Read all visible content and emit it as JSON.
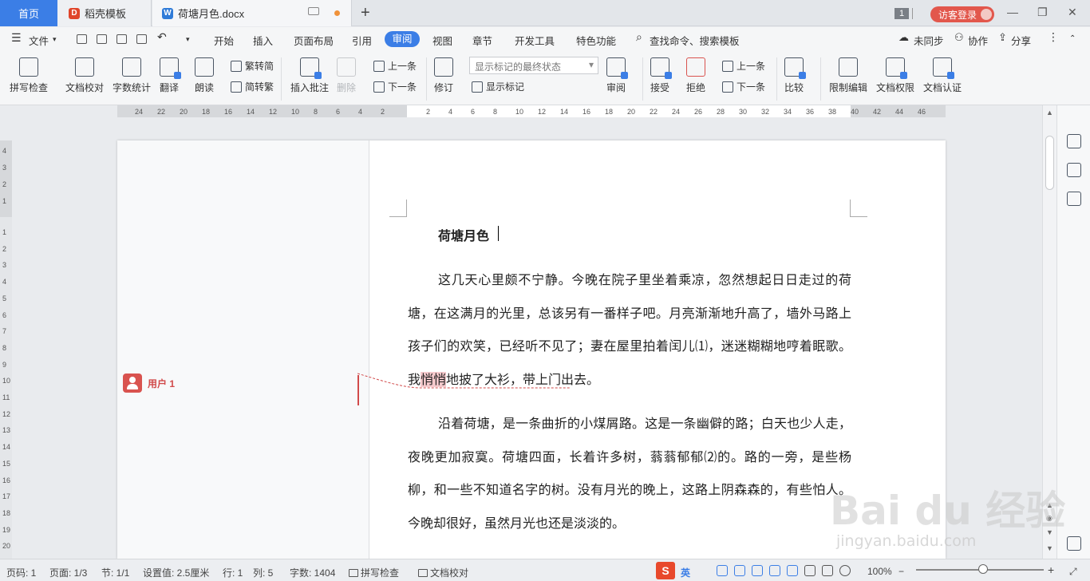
{
  "tabs": {
    "home": "首页",
    "template": "稻壳模板",
    "document": "荷塘月色.docx"
  },
  "window": {
    "count": "1",
    "visitor_login": "访客登录",
    "min": "—",
    "restore": "❐",
    "close": "✕"
  },
  "menu": {
    "file": "文件",
    "items": [
      "开始",
      "插入",
      "页面布局",
      "引用",
      "审阅",
      "视图",
      "章节",
      "开发工具",
      "特色功能"
    ],
    "active": "审阅",
    "search": "查找命令、搜索模板",
    "sync": "未同步",
    "collab": "协作",
    "share": "分享"
  },
  "ribbon": {
    "spell_check": "拼写检查",
    "doc_proof": "文档校对",
    "word_count": "字数统计",
    "translate": "翻译",
    "read_aloud": "朗读",
    "trad_simp": "繁转简",
    "simp_trad": "简转繁",
    "insert_comment": "插入批注",
    "delete": "删除",
    "prev": "上一条",
    "next": "下一条",
    "track": "修订",
    "markup_state": "显示标记的最终状态",
    "show_markup": "显示标记",
    "review": "审阅",
    "accept": "接受",
    "reject": "拒绝",
    "prev2": "上一条",
    "next2": "下一条",
    "compare": "比较",
    "restrict_edit": "限制编辑",
    "doc_permission": "文档权限",
    "doc_auth": "文档认证"
  },
  "ruler": {
    "h_left": [
      "24",
      "22",
      "20",
      "18",
      "16",
      "14",
      "12",
      "10",
      "8",
      "6",
      "4",
      "2"
    ],
    "h_right": [
      "2",
      "4",
      "6",
      "8",
      "10",
      "12",
      "14",
      "16",
      "18",
      "20",
      "22",
      "24",
      "26",
      "28",
      "30",
      "32",
      "34",
      "36",
      "38",
      "40",
      "42",
      "44",
      "46"
    ],
    "v_top": [
      "4",
      "3",
      "2",
      "1"
    ],
    "v_body": [
      "1",
      "2",
      "3",
      "4",
      "5",
      "6",
      "7",
      "8",
      "9",
      "10",
      "11",
      "12",
      "13",
      "14",
      "15",
      "16",
      "17",
      "18",
      "19",
      "20"
    ]
  },
  "document": {
    "title": "荷塘月色",
    "para1_a": "这几天心里颇不宁静。今晚在院子里坐着乘凉，忽然想起日日走过的荷塘，在这满月的光里，总该另有一番样子吧。月亮渐渐地升高了，墙外马路上孩子们的欢笑，已经听不见了；妻在屋里拍着闰儿⑴，迷迷糊糊地哼着眠歌。我",
    "para1_hl": "悄悄",
    "para1_b": "地披了大衫，带上门出去。",
    "para2": "沿着荷塘，是一条曲折的小煤屑路。这是一条幽僻的路；白天也少人走，夜晚更加寂寞。荷塘四面，长着许多树，蓊蓊郁郁⑵的。路的一旁，是些杨柳，和一些不知道名字的树。没有月光的晚上，这路上阴森森的，有些怕人。今晚却很好，虽然月光也还是淡淡的。"
  },
  "comment": {
    "user": "用户 1"
  },
  "status": {
    "page_code": "页码: 1",
    "page": "页面: 1/3",
    "section": "节: 1/1",
    "setting": "设置值: 2.5厘米",
    "row": "行: 1",
    "col": "列: 5",
    "words": "字数: 1404",
    "spell": "拼写检查",
    "proof": "文档校对",
    "ime": "英",
    "zoom": "100%",
    "zoom_level": 0.5
  },
  "watermark": {
    "logo": "Bai du 经验",
    "url": "jingyan.baidu.com"
  }
}
